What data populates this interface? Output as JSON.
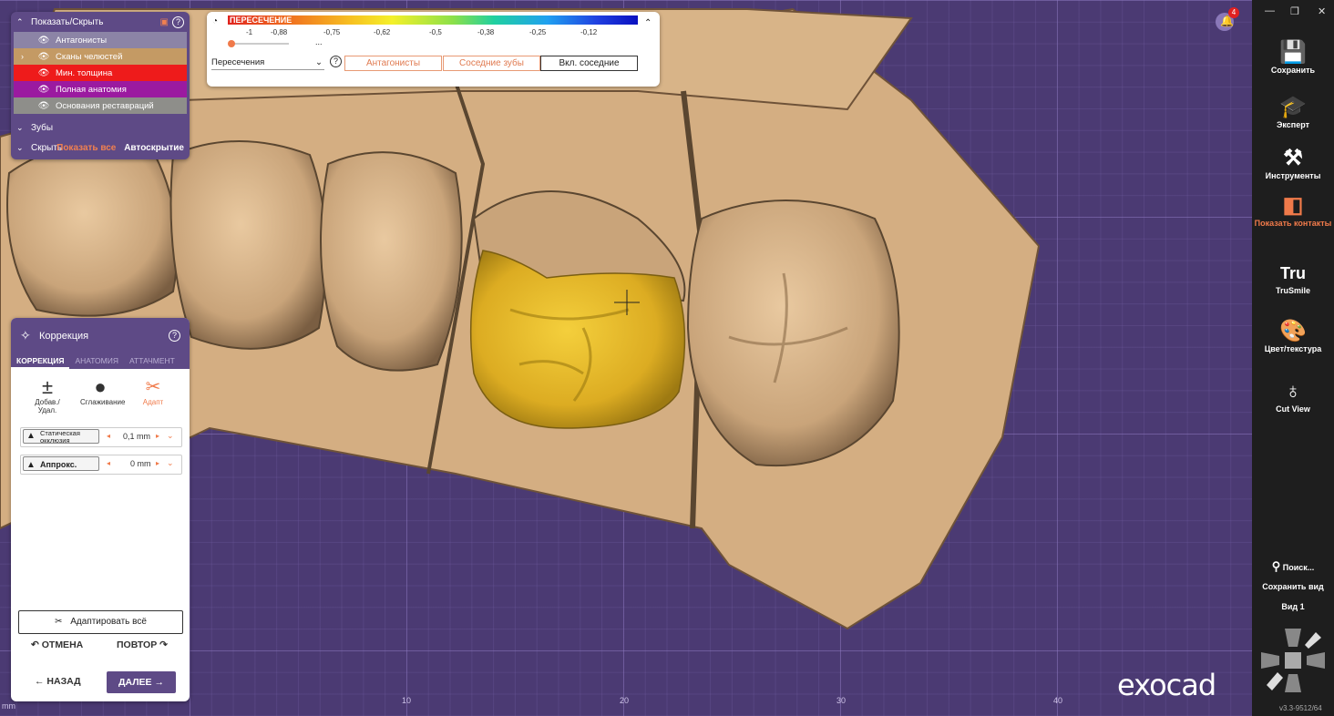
{
  "show_hide": {
    "title": "Показать/Скрыть",
    "layers": [
      {
        "label": "Антагонисты",
        "color": "#8c84a6"
      },
      {
        "label": "Сканы челюстей",
        "color": "#c49a64"
      },
      {
        "label": "Мин. толщина",
        "color": "#ee1b1b"
      },
      {
        "label": "Полная анатомия",
        "color": "#9b1aa0"
      },
      {
        "label": "Основания реставраций",
        "color": "#8e8e8a"
      }
    ],
    "teeth_label": "Зубы",
    "hidden_label": "Скрыть",
    "show_all_label": "Показать все",
    "autohide_label": "Автоскрытие"
  },
  "color_bar": {
    "title": "ПЕРЕСЕЧЕНИЕ",
    "ticks": [
      "-1",
      "-0,88",
      "-0,75",
      "-0,62",
      "-0,5",
      "-0,38",
      "-0,25",
      "-0,12"
    ],
    "slider_dots": "...",
    "mode_select": "Пересечения",
    "antagonists_button": "Антагонисты",
    "adjacent_button": "Соседние зубы",
    "include_adjacent_button": "Вкл. соседние"
  },
  "correction": {
    "title": "Коррекция",
    "tabs": [
      "КОРРЕКЦИЯ",
      "АНАТОМИЯ",
      "АТТАЧМЕНТ"
    ],
    "tools": [
      {
        "label": "Добав./\nУдал.",
        "icon": "plus-minus-icon"
      },
      {
        "label": "Сглаживание",
        "icon": "drop-icon"
      },
      {
        "label": "Адапт",
        "icon": "scissors-icon"
      }
    ],
    "static_occlusion_label": "Статическая окклюзия",
    "static_occlusion_value": "0,1 mm",
    "approx_label": "Аппрокс.",
    "approx_value": "0 mm",
    "adapt_all_label": "Адаптировать всё",
    "undo_label": "ОТМЕНА",
    "redo_label": "ПОВТОР",
    "back_label": "НАЗАД",
    "next_label": "ДАЛЕЕ"
  },
  "toolbar": {
    "items": [
      {
        "label": "Сохранить",
        "icon": "save-icon"
      },
      {
        "label": "Эксперт",
        "icon": "graduation-cap-icon"
      },
      {
        "label": "Инструменты",
        "icon": "tools-icon"
      },
      {
        "label": "Показать контакты",
        "icon": "contacts-icon",
        "active_color": "#f07a4a"
      },
      {
        "label": "TruSmile",
        "icon": "trusmile-icon"
      },
      {
        "label": "Цвет/текстура",
        "icon": "palette-icon"
      },
      {
        "label": "Cut View",
        "icon": "cut-view-icon"
      }
    ],
    "search_label": "Поиск...",
    "save_view_label": "Сохранить вид",
    "view_label": "Вид 1",
    "version": "v3.3-9512/64"
  },
  "notifications_count": "4",
  "brand": "exocad",
  "axis_ticks": [
    "10",
    "20",
    "30",
    "40"
  ],
  "axis_unit": "mm",
  "colors": {
    "panel_purple": "#5e4a86",
    "accent_orange": "#f07a4a",
    "crown_yellow": "#e8b92a",
    "tooth_beige": "#d9b48a"
  }
}
